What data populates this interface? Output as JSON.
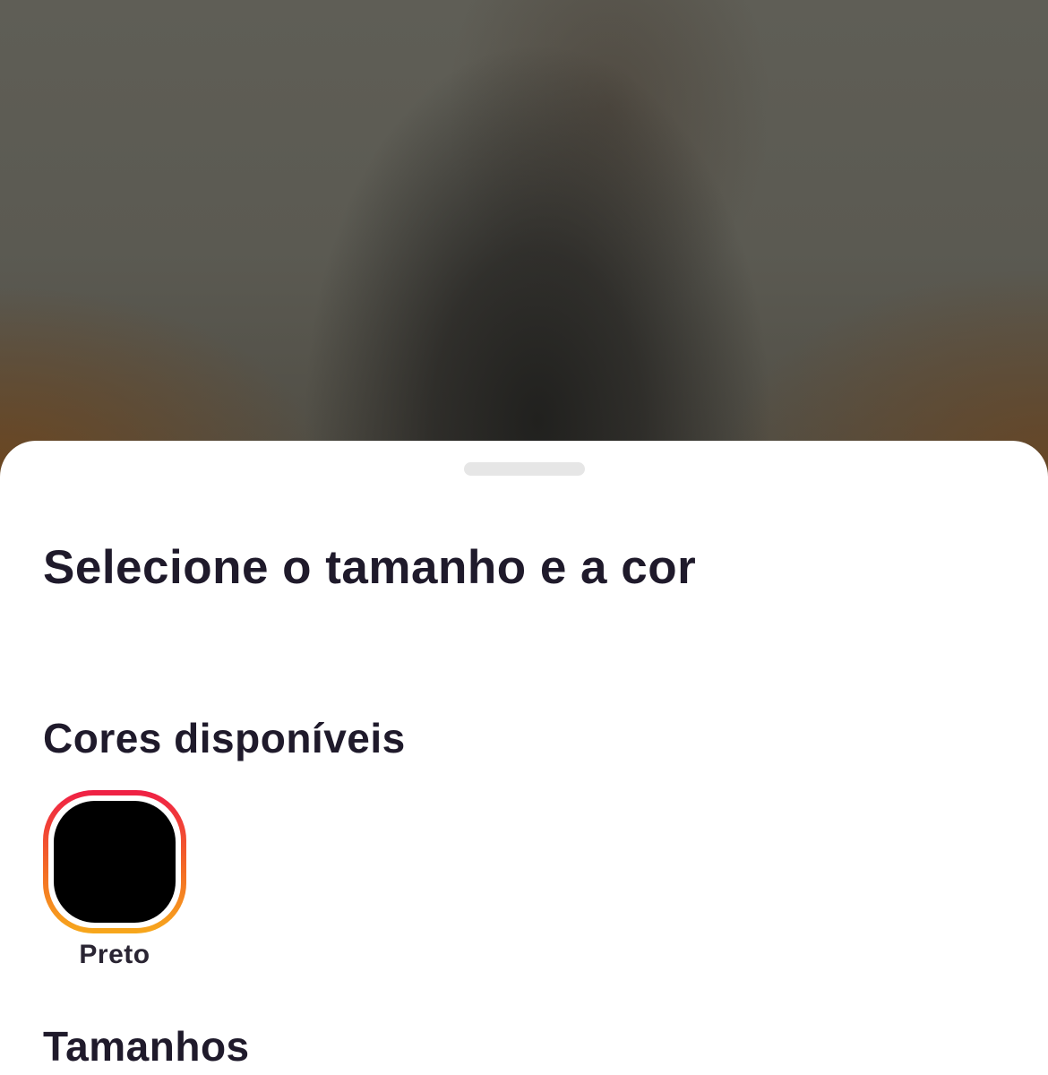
{
  "sheet": {
    "title": "Selecione o tamanho e a cor"
  },
  "colors_section": {
    "title": "Cores disponíveis",
    "options": [
      {
        "label": "Preto",
        "swatch_color": "#000000",
        "selected": true
      }
    ]
  },
  "sizes_section": {
    "title": "Tamanhos"
  },
  "theme": {
    "text_color": "#1f1a2b",
    "selected_ring_gradient": [
      "#ef1f45",
      "#f36a25",
      "#f7a81c"
    ],
    "handle_color": "#e6e6e6"
  }
}
